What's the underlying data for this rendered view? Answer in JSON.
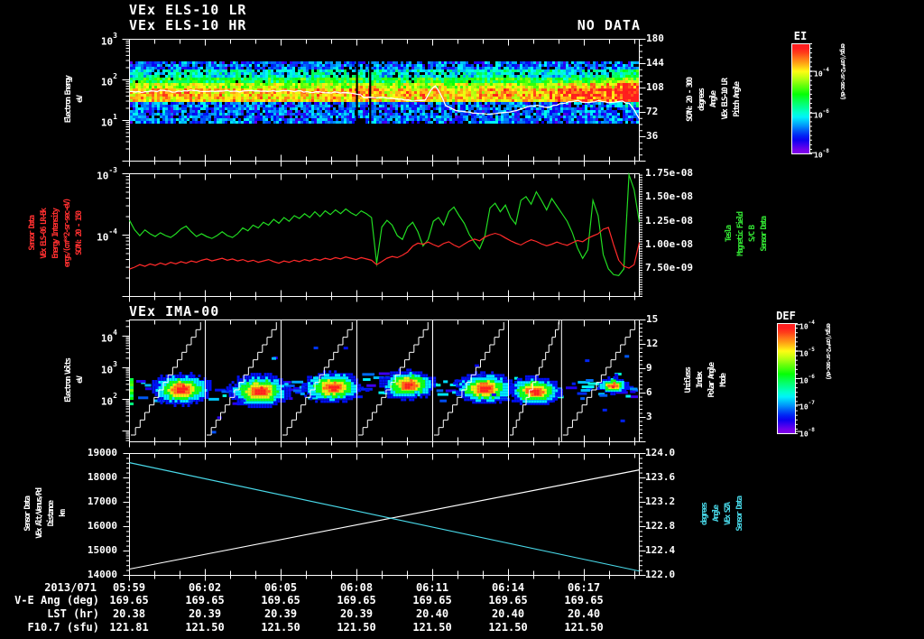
{
  "header": {
    "title_line1": "VEx ELS-10 LR",
    "title_line2": "VEx ELS-10 HR",
    "no_data_label": "NO DATA",
    "panel3_title": "VEx IMA-00"
  },
  "time_axis": {
    "date_label": "2013/071",
    "tick_labels": [
      "05:59",
      "06:02",
      "06:05",
      "06:08",
      "06:11",
      "06:14",
      "06:17"
    ],
    "tick_minutes": [
      0,
      3,
      6,
      9,
      12,
      15,
      18
    ],
    "minutes_span": 20.2
  },
  "table": {
    "row_labels": [
      "V-E Ang (deg)",
      "LST (hr)",
      "F10.7 (sfu)"
    ],
    "rows": [
      [
        "169.65",
        "169.65",
        "169.65",
        "169.65",
        "169.65",
        "169.65",
        "169.65"
      ],
      [
        "20.38",
        "20.39",
        "20.39",
        "20.39",
        "20.40",
        "20.40",
        "20.40"
      ],
      [
        "121.81",
        "121.50",
        "121.50",
        "121.50",
        "121.50",
        "121.50",
        "121.50"
      ]
    ]
  },
  "labels": {
    "p1_left_stack": {
      "texts": [
        "Electron Energy",
        "eV"
      ],
      "color": "#ffffff"
    },
    "p1_left_ticks": {
      "labels": [
        "10^3",
        "10^2",
        "10^1"
      ],
      "values": [
        1000,
        100,
        10
      ]
    },
    "p1_right_ticks": {
      "labels": [
        "180",
        "144",
        "108",
        "72",
        "36"
      ],
      "values": [
        180,
        144,
        108,
        72,
        36
      ]
    },
    "p1_right_stack": {
      "texts": [
        "SCAN: 20 - 300",
        "degrees",
        "Angle",
        "VEx ELS-10 LR",
        "Pitch Angle"
      ],
      "color": "#ffffff"
    },
    "p2_left_stack": {
      "texts": [
        "Sensor Data",
        "VEx ELS-06 LR-Bk",
        "Energy Intensity",
        "ergs/(cm**2-sr-sec-eV)",
        "SCAN: 20 - 150"
      ],
      "color": "#ff3030"
    },
    "p2_left_ticks": {
      "labels": [
        "10^-3",
        "10^-4"
      ],
      "values": [
        0.001,
        0.0001
      ]
    },
    "p2_right_ticks": {
      "labels": [
        "1.75e-08",
        "1.50e-08",
        "1.25e-08",
        "1.00e-08",
        "7.50e-09"
      ],
      "values": [
        1.75e-08,
        1.5e-08,
        1.25e-08,
        1e-08,
        7.5e-09
      ]
    },
    "p2_right_stack": {
      "texts": [
        "Tesla",
        "Magnetic Field",
        "S/C B",
        "Sensor Data"
      ],
      "color": "#33e533"
    },
    "p3_left_stack": {
      "texts": [
        "Electron Volts",
        "eV"
      ],
      "color": "#ffffff"
    },
    "p3_left_ticks": {
      "labels": [
        "10^4",
        "10^3",
        "10^2"
      ],
      "values": [
        10000,
        1000,
        100
      ]
    },
    "p3_right_ticks": {
      "labels": [
        "15",
        "12",
        "9",
        "6",
        "3"
      ],
      "values": [
        15,
        12,
        9,
        6,
        3
      ]
    },
    "p3_right_stack": {
      "texts": [
        "Unitless",
        "Index",
        "Polar Angle",
        "Mode"
      ],
      "color": "#ffffff"
    },
    "p4_left_stack": {
      "texts": [
        "Sensor Data",
        "VEx Alt/Venus/Pd",
        "Distance",
        "km"
      ],
      "color": "#ffffff"
    },
    "p4_left_ticks": {
      "labels": [
        "19000",
        "18000",
        "17000",
        "16000",
        "15000",
        "14000"
      ],
      "values": [
        19000,
        18000,
        17000,
        16000,
        15000,
        14000
      ]
    },
    "p4_right_ticks": {
      "labels": [
        "124.0",
        "123.6",
        "123.2",
        "122.8",
        "122.4",
        "122.0"
      ],
      "values": [
        124.0,
        123.6,
        123.2,
        122.8,
        122.4,
        122.0
      ]
    },
    "p4_right_stack": {
      "texts": [
        "degrees",
        "Angle",
        "VEx SZA",
        "Sensor Data"
      ],
      "color": "#49d8e8"
    }
  },
  "colorbars": [
    {
      "title": "EI",
      "units": "ergs/(cm**2-sr-sec-eV)",
      "tick_labels": [
        "10^-4",
        "10^-6",
        "10^-8"
      ],
      "tick_fracs": [
        0.25,
        0.63,
        0.99
      ]
    },
    {
      "title": "DEF",
      "units": "ergs/(cm**2-sr-sec-eV)",
      "tick_labels": [
        "10^-4",
        "10^-5",
        "10^-6",
        "10^-7",
        "10^-8"
      ],
      "tick_fracs": [
        0.01,
        0.25,
        0.5,
        0.74,
        0.98
      ]
    }
  ],
  "chart_data": [
    {
      "id": "els_pitch_angle_spectrogram",
      "type": "heatmap",
      "instrument": "VEx ELS-10 LR / VEx ELS-10 HR",
      "status": "NO DATA",
      "y_axis": {
        "label": "Electron Energy (eV)",
        "scale": "log",
        "range": [
          1,
          1000
        ]
      },
      "right_axis": {
        "label": "Pitch Angle (degrees)",
        "range": [
          0,
          180
        ],
        "ticks": [
          36,
          72,
          108,
          144,
          180
        ]
      },
      "colorbar": "EI",
      "band": {
        "energy_extent_ev": [
          8,
          280
        ],
        "peak_ev": [
          30,
          85
        ]
      },
      "data_gap_x_frac": [
        0.446,
        0.472
      ],
      "white_trace_ev": [
        [
          0,
          52
        ],
        [
          0.03,
          50
        ],
        [
          0.06,
          54
        ],
        [
          0.09,
          51
        ],
        [
          0.12,
          55
        ],
        [
          0.15,
          52
        ],
        [
          0.18,
          54
        ],
        [
          0.21,
          51
        ],
        [
          0.24,
          54
        ],
        [
          0.27,
          52
        ],
        [
          0.3,
          55
        ],
        [
          0.33,
          52
        ],
        [
          0.36,
          50
        ],
        [
          0.39,
          49
        ],
        [
          0.42,
          48
        ],
        [
          0.446,
          46
        ],
        [
          0.46,
          38
        ],
        [
          0.48,
          36
        ],
        [
          0.5,
          37
        ],
        [
          0.52,
          35
        ],
        [
          0.54,
          33
        ],
        [
          0.56,
          30
        ],
        [
          0.58,
          32
        ],
        [
          0.59,
          55
        ],
        [
          0.6,
          70
        ],
        [
          0.61,
          45
        ],
        [
          0.62,
          24
        ],
        [
          0.64,
          18
        ],
        [
          0.66,
          16
        ],
        [
          0.68,
          15
        ],
        [
          0.7,
          14
        ],
        [
          0.72,
          15
        ],
        [
          0.74,
          16
        ],
        [
          0.76,
          18
        ],
        [
          0.78,
          21
        ],
        [
          0.8,
          24
        ],
        [
          0.82,
          21
        ],
        [
          0.85,
          27
        ],
        [
          0.88,
          30
        ],
        [
          0.9,
          27
        ],
        [
          0.92,
          30
        ],
        [
          0.94,
          28
        ],
        [
          0.96,
          30
        ],
        [
          0.98,
          27
        ],
        [
          0.99,
          18
        ],
        [
          1.0,
          11
        ]
      ]
    },
    {
      "id": "intensity_and_bfield",
      "type": "line",
      "left_axis": {
        "label": "Energy Intensity ergs/(cm**2-sr-sec-eV)",
        "scale": "log",
        "range": [
          1e-05,
          0.001
        ]
      },
      "right_axis": {
        "label": "S/C B Magnetic Field (Tesla)",
        "scale": "linear",
        "range": [
          4.6e-09,
          1.75e-08
        ]
      },
      "series": [
        {
          "name": "Energy Intensity",
          "axis": "left",
          "color": "#ff2a2a",
          "scale_factor": 1e-05,
          "values": [
            2.8,
            3.0,
            3.3,
            3.1,
            3.4,
            3.2,
            3.5,
            3.3,
            3.6,
            3.4,
            3.7,
            3.5,
            3.8,
            3.6,
            3.9,
            4.1,
            3.8,
            4.0,
            4.2,
            3.9,
            4.1,
            3.8,
            4.0,
            3.7,
            3.9,
            3.6,
            3.8,
            4.0,
            3.7,
            3.5,
            3.8,
            3.6,
            3.9,
            3.7,
            4.0,
            3.8,
            4.1,
            3.9,
            4.2,
            4.0,
            4.3,
            4.1,
            4.4,
            4.2,
            4.0,
            4.3,
            4.1,
            3.9,
            3.3,
            3.7,
            4.2,
            4.5,
            4.3,
            4.7,
            5.3,
            6.6,
            7.4,
            7.1,
            7.7,
            7.0,
            6.5,
            7.3,
            7.8,
            6.9,
            6.3,
            7.1,
            8.0,
            8.6,
            8.1,
            9.3,
            10.1,
            10.7,
            10.1,
            9.0,
            8.1,
            7.4,
            6.9,
            7.7,
            8.4,
            7.9,
            7.2,
            6.7,
            7.1,
            7.7,
            7.2,
            6.8,
            7.5,
            8.2,
            7.8,
            8.9,
            9.7,
            10.5,
            12.5,
            13.3,
            7.0,
            3.9,
            3.1,
            2.9,
            3.3,
            7.6
          ]
        },
        {
          "name": "S/C B Magnetic Field",
          "axis": "right",
          "color": "#22dd22",
          "scale_factor": 1e-09,
          "values": [
            12.6,
            11.6,
            11.0,
            11.6,
            11.2,
            10.9,
            11.3,
            11.0,
            10.8,
            11.2,
            11.7,
            12.0,
            11.4,
            10.9,
            11.2,
            10.9,
            10.7,
            11.0,
            11.4,
            11.0,
            10.8,
            11.2,
            11.8,
            11.5,
            12.1,
            11.8,
            12.4,
            12.1,
            12.7,
            12.3,
            12.9,
            12.5,
            13.1,
            12.8,
            13.3,
            12.9,
            13.5,
            13.0,
            13.6,
            13.2,
            13.7,
            13.3,
            13.8,
            13.4,
            13.1,
            13.6,
            13.3,
            12.9,
            8.1,
            11.9,
            12.6,
            12.1,
            11.0,
            10.6,
            11.9,
            12.4,
            11.4,
            9.9,
            10.6,
            12.5,
            12.9,
            12.1,
            13.5,
            14.0,
            13.1,
            12.3,
            11.1,
            10.3,
            9.6,
            10.9,
            13.9,
            14.4,
            13.5,
            14.2,
            12.9,
            12.2,
            14.7,
            15.1,
            14.3,
            15.6,
            14.7,
            13.7,
            14.9,
            14.1,
            13.3,
            12.5,
            11.3,
            9.7,
            8.6,
            9.5,
            14.7,
            13.1,
            9.0,
            7.5,
            6.9,
            6.8,
            7.5,
            17.4,
            15.8,
            12.4
          ]
        }
      ]
    },
    {
      "id": "ima_ion_spectrogram",
      "type": "heatmap",
      "instrument": "VEx IMA-00",
      "y_axis": {
        "label": "Electron Volts (eV)",
        "scale": "log",
        "range_log10": [
          0.66,
          4.51
        ]
      },
      "right_axis": {
        "label": "Mode / Polar Angle Index (Unitless)",
        "range": [
          0,
          15
        ],
        "ticks": [
          3,
          6,
          9,
          12,
          15
        ]
      },
      "colorbar": "DEF",
      "segments": {
        "boundaries_min": [
          3,
          6,
          9,
          12,
          15,
          17.1
        ],
        "blob_center_min": [
          2.0,
          5.1,
          8.0,
          11.0,
          14.0,
          16.0,
          19.1
        ],
        "blob_center_ev": 230,
        "blob_scales": [
          1.0,
          1.05,
          0.98,
          0.92,
          0.98,
          0.9,
          0.5
        ],
        "blob_y_offsets": [
          0,
          2,
          -2,
          -5,
          -1,
          2,
          -4
        ],
        "elevation_ramp": true
      }
    },
    {
      "id": "altitude_and_sza",
      "type": "line",
      "left_axis": {
        "label": "VEx Alt/Venus/Pd Distance (km)",
        "range": [
          14000,
          19000
        ]
      },
      "right_axis": {
        "label": "VEx SZA (degrees)",
        "range": [
          122.0,
          124.0
        ]
      },
      "series": [
        {
          "name": "VEx Alt/Venus/Pd Distance",
          "axis": "left",
          "color": "#ffffff",
          "units": "km",
          "values_endpoints": [
            14260,
            18330
          ]
        },
        {
          "name": "VEx SZA",
          "axis": "right",
          "color": "#49d8e8",
          "units": "degrees",
          "values_endpoints": [
            123.85,
            122.07
          ]
        }
      ]
    }
  ]
}
